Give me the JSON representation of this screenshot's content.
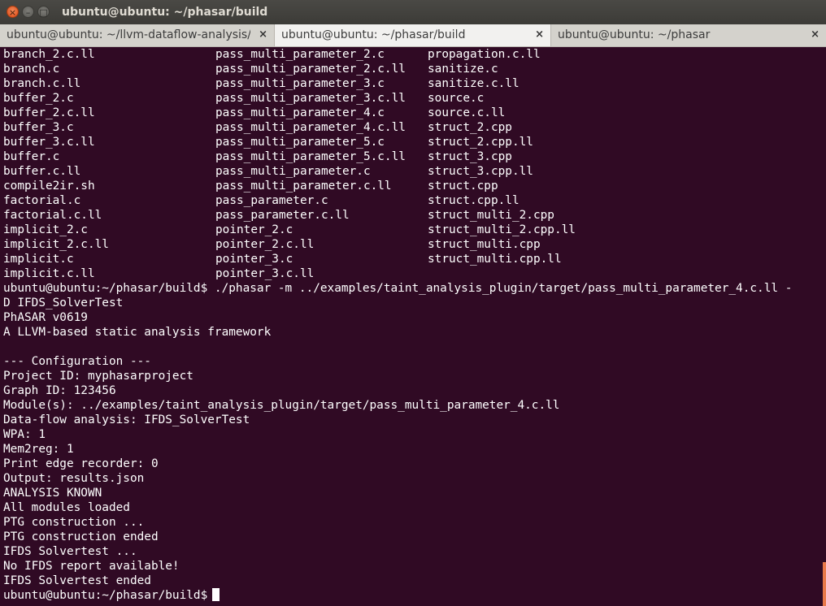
{
  "window": {
    "title": "ubuntu@ubuntu: ~/phasar/build",
    "close_glyph": "×",
    "min_glyph": "–",
    "max_glyph": "□"
  },
  "tabs": [
    {
      "label": "ubuntu@ubuntu: ~/llvm-dataflow-analysis/...",
      "close": "×"
    },
    {
      "label": "ubuntu@ubuntu: ~/phasar/build",
      "close": "×"
    },
    {
      "label": "ubuntu@ubuntu: ~/phasar",
      "close": "×"
    }
  ],
  "listing": {
    "col1": [
      "branch_2.c.ll",
      "branch.c",
      "branch.c.ll",
      "buffer_2.c",
      "buffer_2.c.ll",
      "buffer_3.c",
      "buffer_3.c.ll",
      "buffer.c",
      "buffer.c.ll",
      "compile2ir.sh",
      "factorial.c",
      "factorial.c.ll",
      "implicit_2.c",
      "implicit_2.c.ll",
      "implicit.c",
      "implicit.c.ll"
    ],
    "col2": [
      "pass_multi_parameter_2.c",
      "pass_multi_parameter_2.c.ll",
      "pass_multi_parameter_3.c",
      "pass_multi_parameter_3.c.ll",
      "pass_multi_parameter_4.c",
      "pass_multi_parameter_4.c.ll",
      "pass_multi_parameter_5.c",
      "pass_multi_parameter_5.c.ll",
      "pass_multi_parameter.c",
      "pass_multi_parameter.c.ll",
      "pass_parameter.c",
      "pass_parameter.c.ll",
      "pointer_2.c",
      "pointer_2.c.ll",
      "pointer_3.c",
      "pointer_3.c.ll"
    ],
    "col3": [
      "propagation.c.ll",
      "sanitize.c",
      "sanitize.c.ll",
      "source.c",
      "source.c.ll",
      "struct_2.cpp",
      "struct_2.cpp.ll",
      "struct_3.cpp",
      "struct_3.cpp.ll",
      "struct.cpp",
      "struct.cpp.ll",
      "struct_multi_2.cpp",
      "struct_multi_2.cpp.ll",
      "struct_multi.cpp",
      "struct_multi.cpp.ll",
      ""
    ]
  },
  "output": [
    "ubuntu@ubuntu:~/phasar/build$ ./phasar -m ../examples/taint_analysis_plugin/target/pass_multi_parameter_4.c.ll -",
    "D IFDS_SolverTest",
    "PhASAR v0619",
    "A LLVM-based static analysis framework",
    "",
    "--- Configuration ---",
    "Project ID: myphasarproject",
    "Graph ID: 123456",
    "Module(s): ../examples/taint_analysis_plugin/target/pass_multi_parameter_4.c.ll",
    "Data-flow analysis: IFDS_SolverTest",
    "WPA: 1",
    "Mem2reg: 1",
    "Print edge recorder: 0",
    "Output: results.json",
    "ANALYSIS KNOWN",
    "All modules loaded",
    "PTG construction ...",
    "PTG construction ended",
    "IFDS Solvertest ...",
    "No IFDS report available!",
    "IFDS Solvertest ended"
  ],
  "prompt": "ubuntu@ubuntu:~/phasar/build$"
}
